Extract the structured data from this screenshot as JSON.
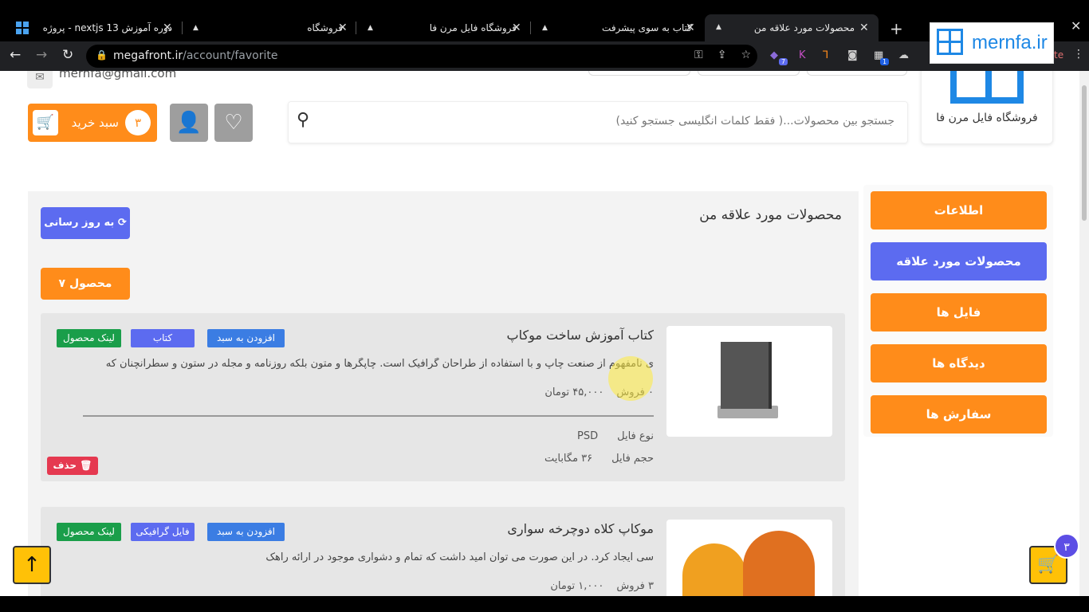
{
  "browser": {
    "tabs": [
      {
        "title": "دوره آموزش nextjs 13 - پروژه"
      },
      {
        "title": "فروشگاه"
      },
      {
        "title": "فروشگاه فایل مرن فا"
      },
      {
        "title": "کتاب به سوی پیشرفت"
      },
      {
        "title": "محصولات مورد علاقه من"
      }
    ],
    "url_host": "megafront.ir",
    "url_path": "/account/favorite",
    "ext_badge_1": "7",
    "ext_badge_2": "1",
    "partial_label": "te"
  },
  "watermark": {
    "text": "mernfa.ir"
  },
  "header": {
    "email": "mernfa@gmail.com",
    "cart_label": "سبد خرید",
    "cart_count": "۳",
    "search_placeholder": "جستجو بین محصولات...( فقط کلمات انگلیسی جستجو کنید)",
    "store_name": "فروشگاه فایل مرن فا"
  },
  "sidebar": {
    "items": [
      {
        "label": "اطلاعات",
        "color": "#ff8c1a"
      },
      {
        "label": "محصولات مورد علاقه",
        "color": "#5c6bf0"
      },
      {
        "label": "فایل ها",
        "color": "#ff8c1a"
      },
      {
        "label": "دیدگاه ها",
        "color": "#ff8c1a"
      },
      {
        "label": "سفارش ها",
        "color": "#ff8c1a"
      }
    ]
  },
  "main": {
    "heading": "محصولات مورد علاقه من",
    "refresh_label": "به روز رسانی",
    "count_label": "۷ محصول",
    "products": [
      {
        "title": "کتاب آموزش ساخت موکاپ",
        "desc": "ی نامفهوم از صنعت چاپ و با استفاده از طراحان گرافیک است. چاپگرها و متون بلکه روزنامه و مجله در ستون و سطرآنچنان که",
        "sales": "۰ فروش",
        "price": "۴۵,۰۰۰ تومان",
        "file_type_label": "نوع فایل",
        "file_type": "PSD",
        "file_size_label": "حجم فایل",
        "file_size": "۳۶ مگابایت",
        "tags": {
          "link": "لینک محصول",
          "category": "کتاب",
          "add": "افزودن به سبد"
        },
        "delete_label": "حذف"
      },
      {
        "title": "موکاپ کلاه دوچرخه سواری",
        "desc": "سی ایجاد کرد. در این صورت می توان امید داشت که تمام و دشواری موجود در ارائه راهک",
        "sales": "۳ فروش",
        "price": "۱,۰۰۰ تومان",
        "tags": {
          "link": "لینک محصول",
          "category": "فایل گرافیکی",
          "add": "افزودن به سبد"
        }
      }
    ]
  },
  "floating": {
    "cart_badge": "۳"
  },
  "colors": {
    "orange": "#ff8c1a",
    "blue": "#5c6bf0",
    "green": "#1a9e4a",
    "red": "#e53950"
  }
}
